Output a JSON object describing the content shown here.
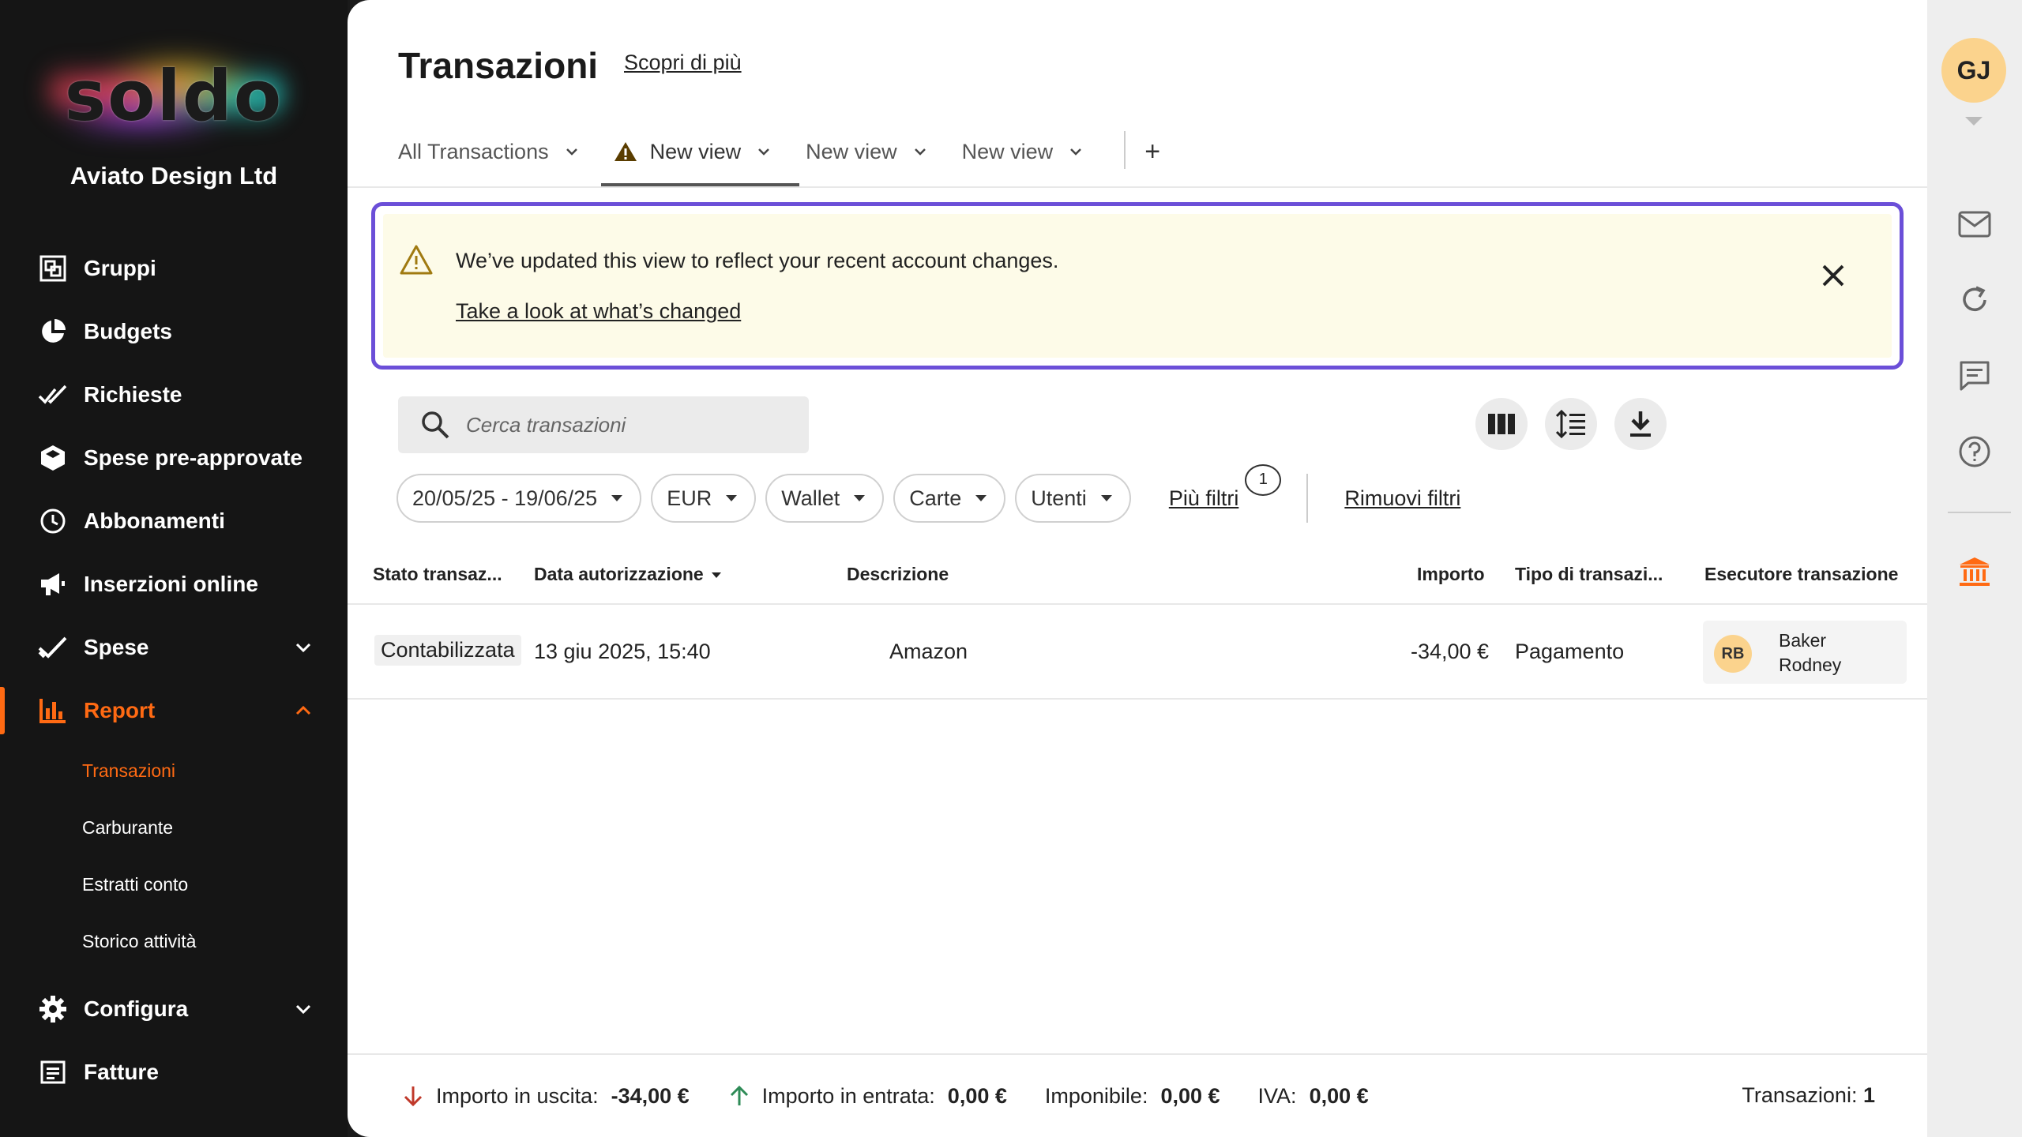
{
  "sidebar": {
    "logo": "soldo",
    "company": "Aviato Design Ltd",
    "items": [
      {
        "label": "Gruppi",
        "icon": "groups-icon"
      },
      {
        "label": "Budgets",
        "icon": "pie-chart-icon"
      },
      {
        "label": "Richieste",
        "icon": "double-check-icon"
      },
      {
        "label": "Spese pre-approvate",
        "icon": "hexagon-icon"
      },
      {
        "label": "Abbonamenti",
        "icon": "clock-icon"
      },
      {
        "label": "Inserzioni online",
        "icon": "megaphone-icon"
      },
      {
        "label": "Spese",
        "icon": "check-icon"
      },
      {
        "label": "Report",
        "icon": "bar-chart-icon"
      },
      {
        "label": "Configura",
        "icon": "gear-icon"
      },
      {
        "label": "Fatture",
        "icon": "invoice-icon"
      }
    ],
    "report_sub": [
      "Transazioni",
      "Carburante",
      "Estratti conto",
      "Storico attività"
    ]
  },
  "header": {
    "title": "Transazioni",
    "learn_more": "Scopri di più"
  },
  "tabs": [
    {
      "label": "All Transactions"
    },
    {
      "label": "New view",
      "active": true,
      "warning": true
    },
    {
      "label": "New view"
    },
    {
      "label": "New view"
    }
  ],
  "tab_add": "+",
  "alert": {
    "message": "We’ve updated this view to reflect your recent account changes.",
    "link": "Take a look at what’s changed"
  },
  "search": {
    "placeholder": "Cerca transazioni"
  },
  "filters": {
    "chips": [
      "20/05/25 - 19/06/25",
      "EUR",
      "Wallet",
      "Carte",
      "Utenti"
    ],
    "more": "Più filtri",
    "more_count": "1",
    "remove": "Rimuovi filtri"
  },
  "table": {
    "headers": {
      "status": "Stato transaz...",
      "date": "Data autorizzazione",
      "description": "Descrizione",
      "amount": "Importo",
      "type": "Tipo di transazi...",
      "executor": "Esecutore transazione"
    },
    "rows": [
      {
        "status": "Contabilizzata",
        "date": "13 giu 2025, 15:40",
        "description": "Amazon",
        "amount": "-34,00 €",
        "type": "Pagamento",
        "executor_initials": "RB",
        "executor_name": "Baker\nRodney"
      }
    ]
  },
  "footer": {
    "out_label": "Importo in uscita:",
    "out_value": "-34,00 €",
    "in_label": "Importo in entrata:",
    "in_value": "0,00 €",
    "taxable_label": "Imponibile:",
    "taxable_value": "0,00 €",
    "vat_label": "IVA:",
    "vat_value": "0,00 €",
    "count_label": "Transazioni:",
    "count_value": "1"
  },
  "rail": {
    "user_initials": "GJ"
  },
  "colors": {
    "accent": "#ff6a13",
    "alert_border": "#6b4fd8",
    "alert_bg": "#fdfbe8",
    "avatar": "#fbd38d",
    "out_arrow": "#c0392b",
    "in_arrow": "#2e8b57"
  }
}
